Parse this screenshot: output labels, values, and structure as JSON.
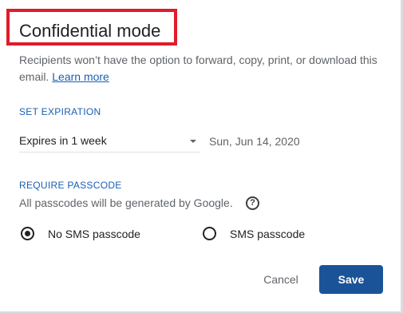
{
  "dialog": {
    "title": "Confidential mode",
    "description": "Recipients won’t have the option to forward, copy, print, or download this email.",
    "learn_more": "Learn more"
  },
  "expiration": {
    "label": "SET EXPIRATION",
    "selected": "Expires in 1 week",
    "date": "Sun, Jun 14, 2020"
  },
  "passcode": {
    "label": "REQUIRE PASSCODE",
    "note": "All passcodes will be generated by Google.",
    "help_icon": "help-circle-icon",
    "options": [
      {
        "label": "No SMS passcode",
        "checked": true
      },
      {
        "label": "SMS passcode",
        "checked": false
      }
    ]
  },
  "actions": {
    "cancel": "Cancel",
    "save": "Save"
  },
  "colors": {
    "accent": "#1a5fb4",
    "save_button": "#1a5398",
    "highlight_border": "#e01b2b"
  }
}
